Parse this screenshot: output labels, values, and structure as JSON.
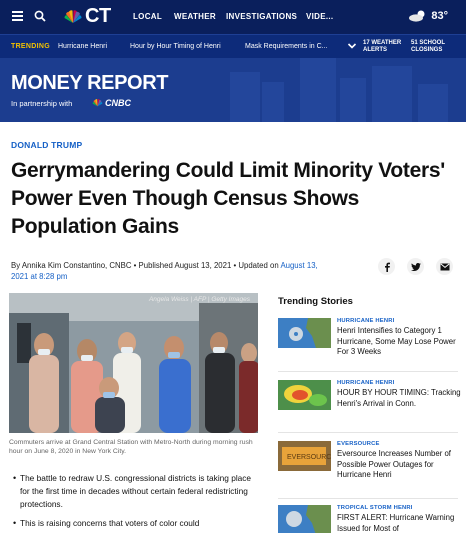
{
  "nav": {
    "logo_text": "CT",
    "links": [
      "LOCAL",
      "WEATHER",
      "INVESTIGATIONS",
      "VIDE..."
    ],
    "weather_temp": "83°"
  },
  "trending_bar": {
    "label": "TRENDING",
    "items": [
      "Hurricane Henri",
      "Hour by Hour Timing of Henri",
      "Mask Requirements in C..."
    ],
    "weather_alerts_count": "17 WEATHER",
    "weather_alerts_label": "ALERTS",
    "closings_count": "51 SCHOOL",
    "closings_label": "CLOSINGS"
  },
  "banner": {
    "title": "MONEY REPORT",
    "partner_text": "In partnership with",
    "partner_name": "CNBC"
  },
  "article": {
    "category": "DONALD TRUMP",
    "headline": "Gerrymandering Could Limit Minority Voters' Power Even Though Census Shows Population Gains",
    "byline_prefix": "By Annika Kim Constantino, CNBC • Published August 13, 2021 • Updated on",
    "byline_updated": "August 13, 2021 at 8:28 pm",
    "photo_credit": "Angela Weiss | AFP | Getty Images",
    "caption": "Commuters arrive at Grand Central Station with Metro-North during morning rush hour on June 8, 2020 in New York City.",
    "bullets": [
      "The battle to redraw U.S. congressional districts is taking place for the first time in decades without certain federal redistricting protections.",
      "This is raising concerns that voters of color could"
    ]
  },
  "share": {
    "facebook_icon": "f",
    "twitter_icon": "t",
    "email_icon": "email"
  },
  "trending_stories": {
    "title": "Trending Stories",
    "items": [
      {
        "tag": "HURRICANE HENRI",
        "text": "Henri Intensifies to Category 1 Hurricane, Some May Lose Power For 3 Weeks",
        "thumb": "map-thumbnail"
      },
      {
        "tag": "HURRICANE HENRI",
        "text": "HOUR BY HOUR TIMING: Tracking Henri's Arrival in Conn.",
        "thumb": "radar-thumbnail"
      },
      {
        "tag": "EVERSOURCE",
        "text": "Eversource Increases Number of Possible Power Outages for Hurricane Henri",
        "thumb": "truck-thumbnail"
      },
      {
        "tag": "TROPICAL STORM HENRI",
        "text": "FIRST ALERT: Hurricane Warning Issued for Most of",
        "thumb": "map-thumbnail"
      }
    ]
  },
  "colors": {
    "nav_bg": "#0a1f5c",
    "trend_bg": "#0d2b7a",
    "banner_bg": "#1c3d8f",
    "accent_blue": "#1560c6",
    "trending_label": "#f2c200"
  }
}
